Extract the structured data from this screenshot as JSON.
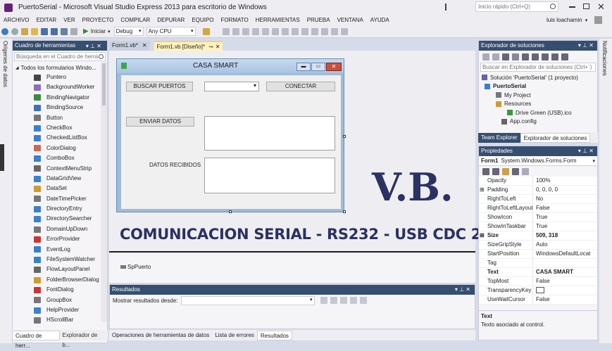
{
  "window": {
    "title": "PuertoSerial - Microsoft Visual Studio Express 2013 para escritorio de Windows",
    "quick_launch": "Inicio rápido (Ctrl+Q)",
    "user": "luis loachamin"
  },
  "menu": [
    "ARCHIVO",
    "EDITAR",
    "VER",
    "PROYECTO",
    "COMPILAR",
    "DEPURAR",
    "EQUIPO",
    "FORMATO",
    "HERRAMIENTAS",
    "PRUEBA",
    "VENTANA",
    "AYUDA"
  ],
  "toolbar": {
    "start": "Iniciar",
    "config": "Debug",
    "platform": "Any CPU"
  },
  "left_vtabs": [
    "Orígenes de datos"
  ],
  "right_vtabs": [
    "Notificaciones"
  ],
  "toolbox": {
    "title": "Cuadro de herramientas",
    "search": "Búsqueda en el Cuadro de herra",
    "group": "Todos los formularios Windo...",
    "items": [
      "Puntero",
      "BackgroundWorker",
      "BindingNavigator",
      "BindingSource",
      "Button",
      "CheckBox",
      "CheckedListBox",
      "ColorDialog",
      "ComboBox",
      "ContextMenuStrip",
      "DataGridView",
      "DataSet",
      "DateTimePicker",
      "DirectoryEntry",
      "DirectorySearcher",
      "DomainUpDown",
      "ErrorProvider",
      "EventLog",
      "FileSystemWatcher",
      "FlowLayoutPanel",
      "FolderBrowserDialog",
      "FontDialog",
      "GroupBox",
      "HelpProvider",
      "HScrollBar"
    ],
    "bottom_tabs": [
      "Cuadro de herr...",
      "Explorador de b..."
    ]
  },
  "doc_tabs": [
    "Form1.vb*",
    "Form1.vb [Diseño]*"
  ],
  "form": {
    "title": "CASA SMART",
    "btn_buscar": "BUSCAR PUERTOS",
    "btn_conectar": "CONECTAR",
    "btn_enviar": "ENVIAR DATOS",
    "label_recibidos": "DATOS RECIBIDOS"
  },
  "overlay": {
    "vb": "V.B.",
    "banner": "COMUNICACION SERIAL - RS232 - USB CDC 232"
  },
  "component_tray": [
    "SpPuerto"
  ],
  "results": {
    "title": "Resultados",
    "show_from": "Mostrar resultados desde:"
  },
  "bottom_tabs": [
    "Operaciones de herramientas de datos",
    "Lista de errores",
    "Resultados"
  ],
  "solution_explorer": {
    "title": "Explorador de soluciones",
    "search": "Buscar en Explorador de soluciones (Ctrl+`)",
    "tree": [
      "Solución 'PuertoSerial' (1 proyecto)",
      "PuertoSerial",
      "My Project",
      "Resources",
      "Drive Green (USB).ico",
      "App.config"
    ],
    "tabs": [
      "Team Explorer",
      "Explorador de soluciones"
    ]
  },
  "properties": {
    "title": "Propiedades",
    "object": "Form1",
    "object_type": "System.Windows.Forms.Form",
    "rows": [
      {
        "name": "Opacity",
        "value": "100%",
        "expand": false
      },
      {
        "name": "Padding",
        "value": "0, 0, 0, 0",
        "expand": true
      },
      {
        "name": "RightToLeft",
        "value": "No",
        "expand": false
      },
      {
        "name": "RightToLeftLayout",
        "value": "False",
        "expand": false
      },
      {
        "name": "ShowIcon",
        "value": "True",
        "expand": false
      },
      {
        "name": "ShowInTaskbar",
        "value": "True",
        "expand": false
      },
      {
        "name": "Size",
        "value": "509, 318",
        "expand": true,
        "bold": true
      },
      {
        "name": "SizeGripStyle",
        "value": "Auto",
        "expand": false
      },
      {
        "name": "StartPosition",
        "value": "WindowsDefaultLocat",
        "expand": false
      },
      {
        "name": "Tag",
        "value": "",
        "expand": false
      },
      {
        "name": "Text",
        "value": "CASA SMART",
        "expand": false,
        "bold": true
      },
      {
        "name": "TopMost",
        "value": "False",
        "expand": false
      },
      {
        "name": "TransparencyKey",
        "value": "",
        "expand": false
      },
      {
        "name": "UseWaitCursor",
        "value": "False",
        "expand": false
      }
    ],
    "desc_title": "Text",
    "desc": "Texto asociado al control."
  },
  "colors": {
    "accent": "#007acc",
    "panel_title": "#364e6f",
    "overlay_text": "#2b3163",
    "designer_bg": "#eeeef2"
  }
}
